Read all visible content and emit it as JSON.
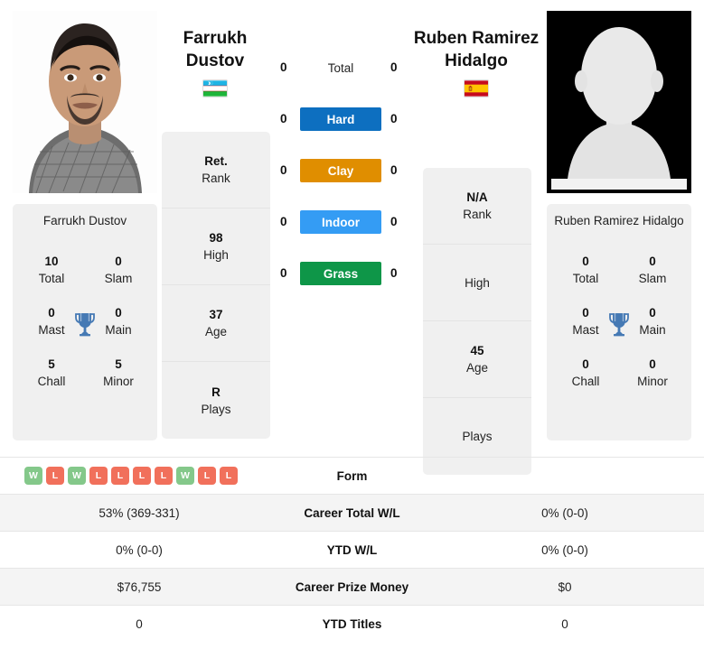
{
  "players": {
    "left": {
      "name_heading": "Farrukh\nDustov",
      "name_line1": "Farrukh",
      "name_line2": "Dustov",
      "card_name": "Farrukh Dustov",
      "country": "Uzbekistan",
      "flag": "uz-flag-icon",
      "photo": "player-photo",
      "stats": [
        {
          "value": "10",
          "label": "Total"
        },
        {
          "value": "0",
          "label": "Slam"
        },
        {
          "value": "0",
          "label": "Mast"
        },
        {
          "value": "0",
          "label": "Main"
        },
        {
          "value": "5",
          "label": "Chall"
        },
        {
          "value": "5",
          "label": "Minor"
        }
      ],
      "info": [
        {
          "value": "Ret.",
          "label": "Rank"
        },
        {
          "value": "98",
          "label": "High"
        },
        {
          "value": "37",
          "label": "Age"
        },
        {
          "value": "R",
          "label": "Plays"
        }
      ]
    },
    "right": {
      "name_heading": "Ruben Ramirez\nHidalgo",
      "name_line1": "Ruben Ramirez",
      "name_line2": "Hidalgo",
      "card_name": "Ruben Ramirez Hidalgo",
      "country": "Spain",
      "flag": "es-flag-icon",
      "photo": "player-photo-placeholder",
      "stats": [
        {
          "value": "0",
          "label": "Total"
        },
        {
          "value": "0",
          "label": "Slam"
        },
        {
          "value": "0",
          "label": "Mast"
        },
        {
          "value": "0",
          "label": "Main"
        },
        {
          "value": "0",
          "label": "Chall"
        },
        {
          "value": "0",
          "label": "Minor"
        }
      ],
      "info": [
        {
          "value": "N/A",
          "label": "Rank"
        },
        {
          "value": "",
          "label": "High"
        },
        {
          "value": "45",
          "label": "Age"
        },
        {
          "value": "",
          "label": "Plays"
        }
      ]
    }
  },
  "surfaces": [
    {
      "label": "Total",
      "left": "0",
      "right": "0",
      "color": "transparent",
      "text_color": "#222222"
    },
    {
      "label": "Hard",
      "left": "0",
      "right": "0",
      "color": "#0d6fc0",
      "text_color": "#ffffff"
    },
    {
      "label": "Clay",
      "left": "0",
      "right": "0",
      "color": "#e08e00",
      "text_color": "#ffffff"
    },
    {
      "label": "Indoor",
      "left": "0",
      "right": "0",
      "color": "#349cf4",
      "text_color": "#ffffff"
    },
    {
      "label": "Grass",
      "left": "0",
      "right": "0",
      "color": "#0e9648",
      "text_color": "#ffffff"
    }
  ],
  "table": {
    "form_label": "Form",
    "form_badges": [
      "W",
      "L",
      "W",
      "L",
      "L",
      "L",
      "L",
      "W",
      "L",
      "L"
    ],
    "form_right": "",
    "rows": [
      {
        "left": "53% (369-331)",
        "label": "Career Total W/L",
        "right": "0% (0-0)"
      },
      {
        "left": "0% (0-0)",
        "label": "YTD W/L",
        "right": "0% (0-0)"
      },
      {
        "left": "$76,755",
        "label": "Career Prize Money",
        "right": "$0"
      },
      {
        "left": "0",
        "label": "YTD Titles",
        "right": "0"
      }
    ]
  },
  "colors": {
    "hard": "#0d6fc0",
    "clay": "#e08e00",
    "indoor": "#349cf4",
    "grass": "#0e9648",
    "win": "#84c88a",
    "loss": "#f1705b",
    "card_bg": "#f0f0f0",
    "trophy": "#4579b4"
  }
}
